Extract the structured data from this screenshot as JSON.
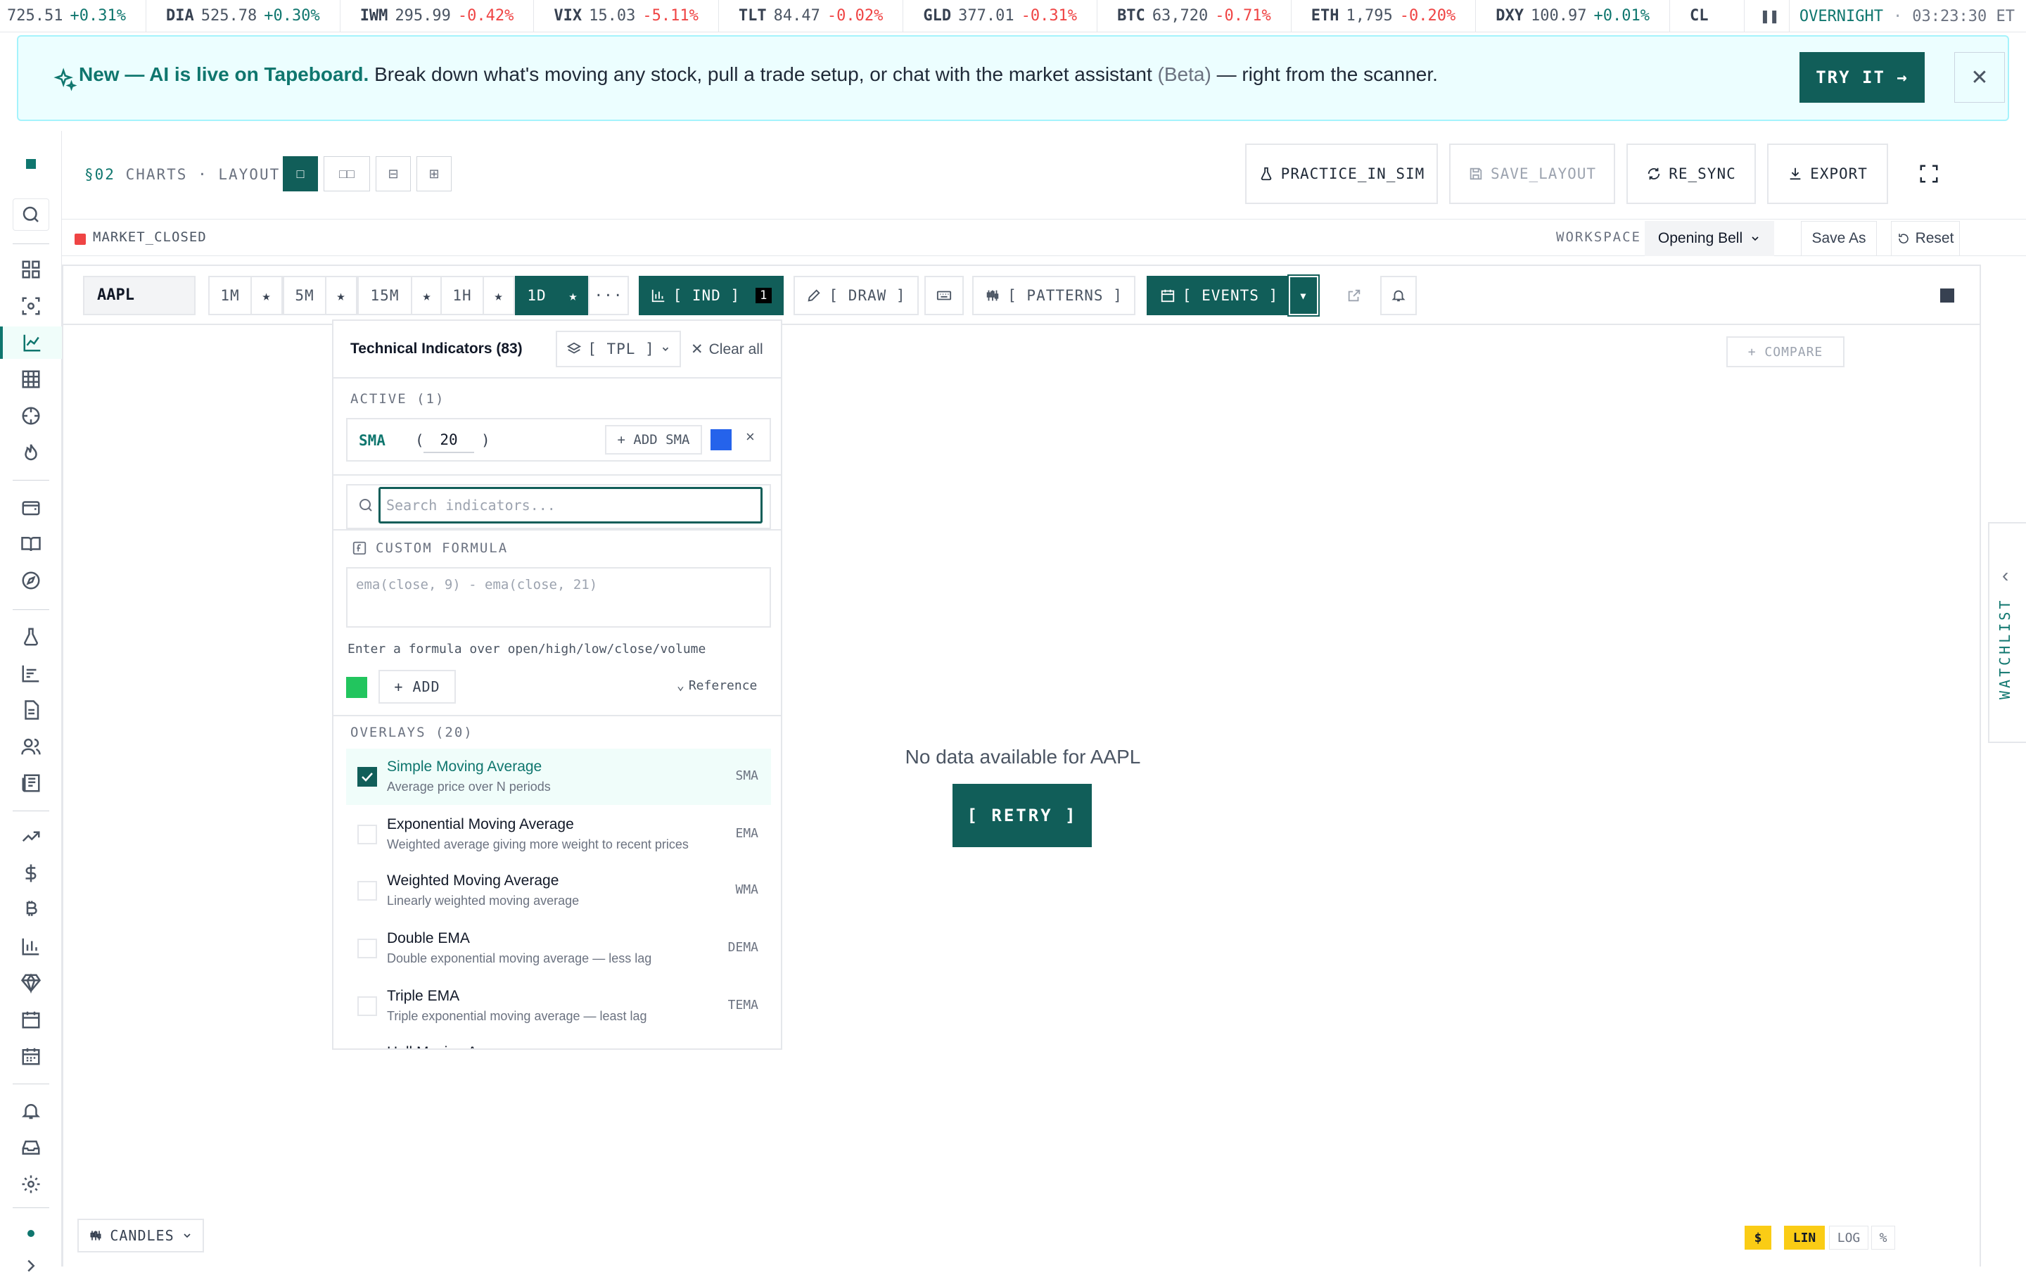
{
  "ticker": [
    {
      "sym": "",
      "price": "725.51",
      "chg": "+0.31%",
      "dir": "up"
    },
    {
      "sym": "DIA",
      "price": "525.78",
      "chg": "+0.30%",
      "dir": "up"
    },
    {
      "sym": "IWM",
      "price": "295.99",
      "chg": "-0.42%",
      "dir": "dn"
    },
    {
      "sym": "VIX",
      "price": "15.03",
      "chg": "-5.11%",
      "dir": "dn"
    },
    {
      "sym": "TLT",
      "price": "84.47",
      "chg": "-0.02%",
      "dir": "dn"
    },
    {
      "sym": "GLD",
      "price": "377.01",
      "chg": "-0.31%",
      "dir": "dn"
    },
    {
      "sym": "BTC",
      "price": "63,720",
      "chg": "-0.71%",
      "dir": "dn"
    },
    {
      "sym": "ETH",
      "price": "1,795",
      "chg": "-0.20%",
      "dir": "dn"
    },
    {
      "sym": "DXY",
      "price": "100.97",
      "chg": "+0.01%",
      "dir": "up"
    },
    {
      "sym": "CL",
      "price": "",
      "chg": "",
      "dir": "up"
    }
  ],
  "ticker_status": {
    "session": "OVERNIGHT",
    "sep": "·",
    "time": "03:23:30 ET"
  },
  "banner": {
    "headline": "New — AI is live on Tapeboard.",
    "body": "Break down what's moving any stock, pull a trade setup, or chat with the market assistant",
    "beta": "(Beta)",
    "tail": "— right from the scanner.",
    "cta": "TRY IT →",
    "close": "✕"
  },
  "header": {
    "section": "§02",
    "title": "CHARTS · LAYOUT",
    "layouts": [
      "□",
      "□□",
      "⊟",
      "⊞"
    ],
    "practice": "PRACTICE_IN_SIM",
    "save_layout": "SAVE_LAYOUT",
    "resync": "RE_SYNC",
    "export": "EXPORT"
  },
  "status": {
    "market": "MARKET_CLOSED",
    "workspace_label": "WORKSPACE",
    "workspace": "Opening Bell",
    "save_as": "Save As",
    "reset": "Reset"
  },
  "toolbar": {
    "symbol": "AAPL",
    "timeframes": [
      "1M",
      "5M",
      "15M",
      "1H",
      "1D"
    ],
    "active_tf": "1D",
    "star": "★",
    "more": "···",
    "ind": "[ IND ]",
    "ind_count": "1",
    "draw": "[ DRAW ]",
    "patterns": "[ PATTERNS ]",
    "events": "[ EVENTS ]",
    "caret": "▾"
  },
  "chart": {
    "compare": "+ COMPARE",
    "no_data": "No data available for AAPL",
    "retry": "[ RETRY ]",
    "chart_type": "CANDLES",
    "scales": [
      "$",
      "LIN",
      "LOG",
      "%"
    ]
  },
  "watchlist": {
    "label": "WATCHLIST",
    "chevron": "‹"
  },
  "indicators_panel": {
    "title": "Technical Indicators (83)",
    "tpl": "[ TPL ]",
    "clear_all": "Clear all",
    "active_label": "ACTIVE (1)",
    "active": {
      "name": "SMA",
      "open": "(",
      "period": "20",
      "close": ")",
      "add": "+ ADD SMA",
      "color": "#2563eb",
      "remove": "×"
    },
    "search_placeholder": "Search indicators...",
    "custom_label": "CUSTOM FORMULA",
    "formula_placeholder": "ema(close, 9) - ema(close, 21)",
    "formula_hint": "Enter a formula over open/high/low/close/volume",
    "formula_color": "#22c55e",
    "add": "+ ADD",
    "reference": "Reference",
    "overlays_label": "OVERLAYS (20)",
    "overlays": [
      {
        "name": "Simple Moving Average",
        "desc": "Average price over N periods",
        "abbr": "SMA",
        "checked": true
      },
      {
        "name": "Exponential Moving Average",
        "desc": "Weighted average giving more weight to recent prices",
        "abbr": "EMA",
        "checked": false
      },
      {
        "name": "Weighted Moving Average",
        "desc": "Linearly weighted moving average",
        "abbr": "WMA",
        "checked": false
      },
      {
        "name": "Double EMA",
        "desc": "Double exponential moving average — less lag",
        "abbr": "DEMA",
        "checked": false
      },
      {
        "name": "Triple EMA",
        "desc": "Triple exponential moving average — least lag",
        "abbr": "TEMA",
        "checked": false
      },
      {
        "name": "Hull Moving Average",
        "desc": "",
        "abbr": "",
        "checked": false
      }
    ]
  },
  "colors": {
    "accent": "#115e59",
    "up": "#0f766e",
    "down": "#ef4444",
    "banner_bg": "#ecfeff"
  }
}
